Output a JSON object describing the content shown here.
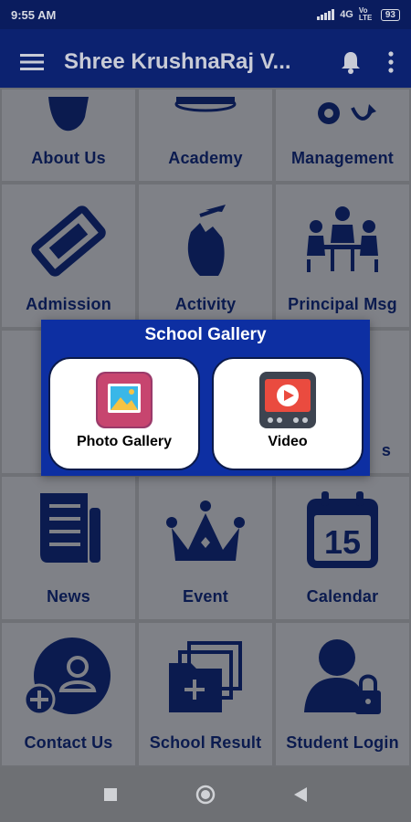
{
  "status_bar": {
    "time": "9:55 AM",
    "network": "4G",
    "volte": "Vo LTE",
    "battery": "93"
  },
  "app_bar": {
    "title": "Shree KrushnaRaj V..."
  },
  "tiles": [
    {
      "label": "About Us",
      "icon": "person-brain-icon"
    },
    {
      "label": "Academy",
      "icon": "graduation-cap-icon"
    },
    {
      "label": "Management",
      "icon": "gears-icon"
    },
    {
      "label": "Admission",
      "icon": "ticket-icon"
    },
    {
      "label": "Activity",
      "icon": "hand-pencil-icon"
    },
    {
      "label": "Principal Msg",
      "icon": "meeting-icon"
    },
    {
      "label": "",
      "icon": "person-board-icon"
    },
    {
      "label": "",
      "icon": "building-icon"
    },
    {
      "label": "s",
      "icon": "building-icon"
    },
    {
      "label": "News",
      "icon": "newspaper-icon"
    },
    {
      "label": "Event",
      "icon": "crown-icon"
    },
    {
      "label": "Calendar",
      "icon": "calendar-icon"
    },
    {
      "label": "Contact Us",
      "icon": "add-contact-icon"
    },
    {
      "label": "School Result",
      "icon": "folders-icon"
    },
    {
      "label": "Student Login",
      "icon": "user-lock-icon"
    }
  ],
  "calendar_day": "15",
  "dialog": {
    "title": "School Gallery",
    "options": [
      {
        "label": "Photo Gallery",
        "icon": "photo-gallery-icon"
      },
      {
        "label": "Video",
        "icon": "video-player-icon"
      }
    ]
  },
  "colors": {
    "app_bar": "#0c2270",
    "status_bar": "#0a1c5e",
    "dialog": "#0d2fa2",
    "icon": "#0b1b4f",
    "scrim_tile": "#7f8187"
  }
}
